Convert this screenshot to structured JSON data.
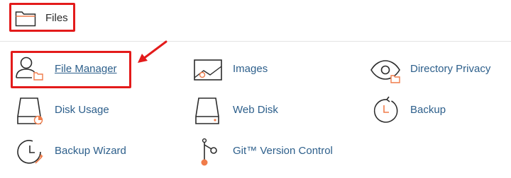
{
  "section": {
    "title": "Files",
    "icon": "folder-icon"
  },
  "items": [
    {
      "label": "File Manager",
      "icon": "file-manager-icon",
      "active": true
    },
    {
      "label": "Images",
      "icon": "image-icon"
    },
    {
      "label": "Directory Privacy",
      "icon": "eye-folder-icon"
    },
    {
      "label": "Disk Usage",
      "icon": "disk-usage-icon"
    },
    {
      "label": "Web Disk",
      "icon": "web-disk-icon"
    },
    {
      "label": "Backup",
      "icon": "backup-icon"
    },
    {
      "label": "Backup Wizard",
      "icon": "backup-wizard-icon"
    },
    {
      "label": "Git™ Version Control",
      "icon": "git-icon"
    }
  ],
  "colors": {
    "accent": "#f07c4a",
    "link": "#2d5f8b",
    "highlight": "#e31b1b",
    "icon_stroke": "#2b2b2b"
  }
}
